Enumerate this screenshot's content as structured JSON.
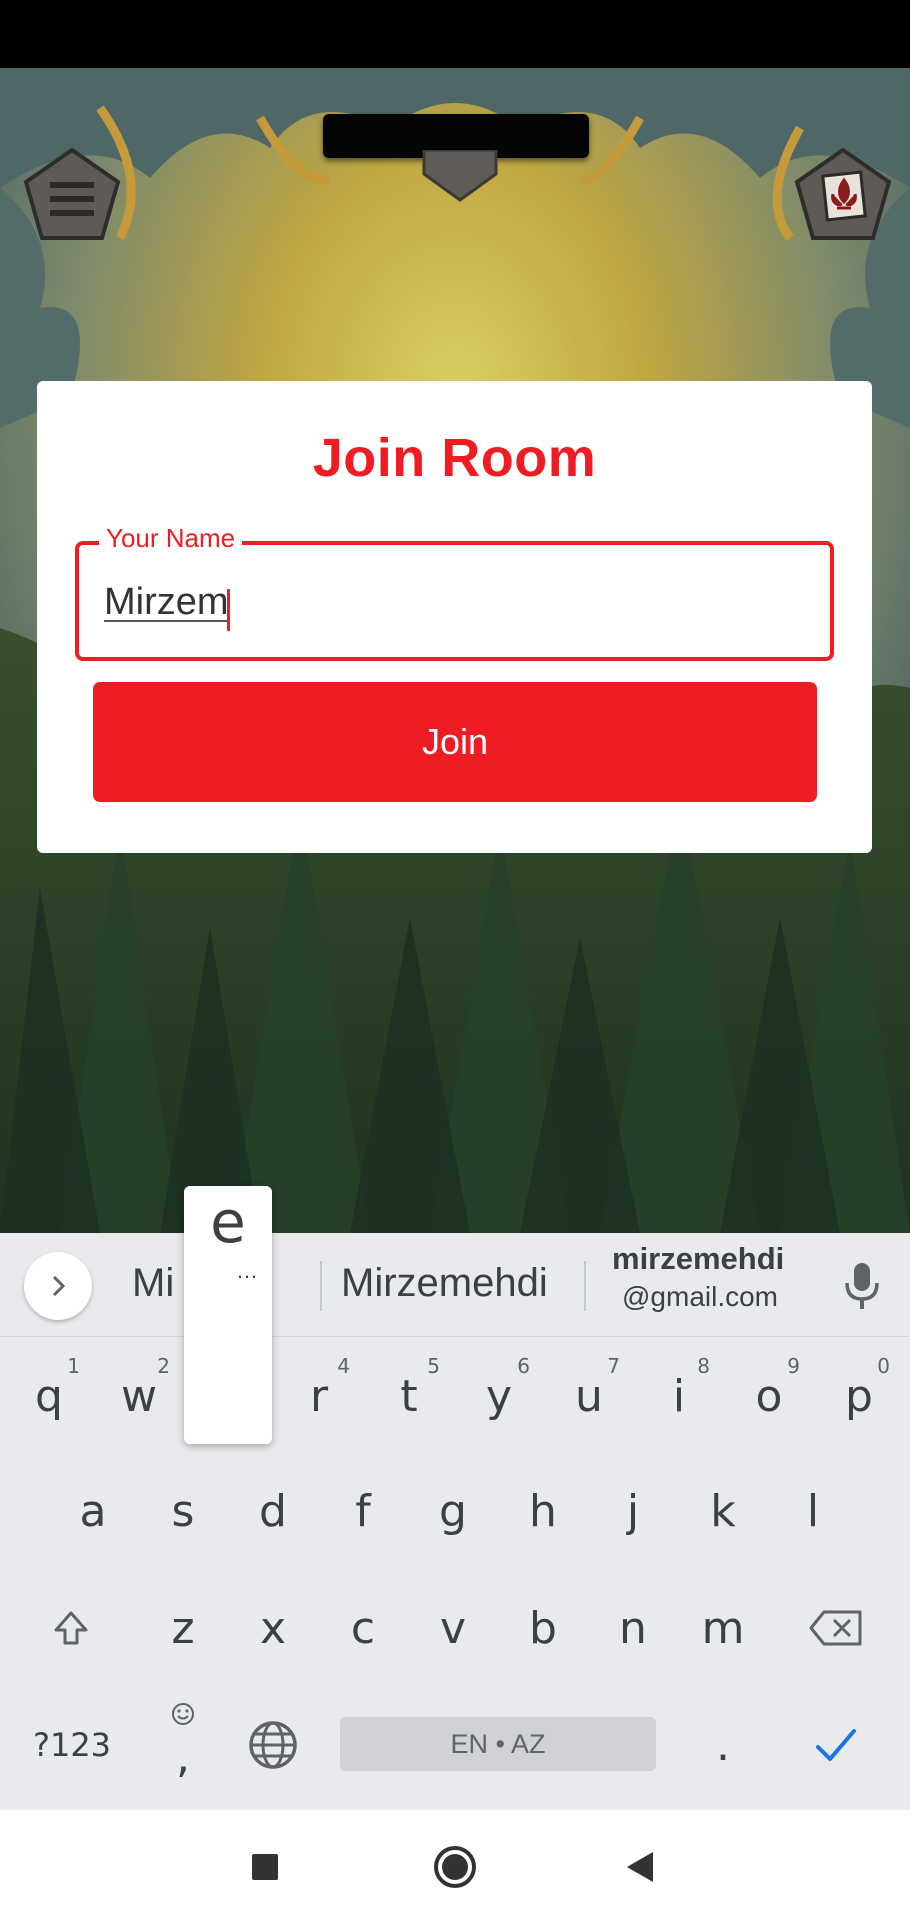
{
  "modal": {
    "title": "Join Room",
    "name_label": "Your Name",
    "name_value": "Mirzem",
    "join_label": "Join"
  },
  "keyboard": {
    "suggestions": [
      "Mi",
      "Mirzemehdi",
      "mirzemehdi",
      "@gmail.com"
    ],
    "popup_key": "e",
    "popup_more": "…",
    "row1": [
      "q",
      "w",
      "e",
      "r",
      "t",
      "y",
      "u",
      "i",
      "o",
      "p"
    ],
    "row1_hints": [
      "1",
      "2",
      "3",
      "4",
      "5",
      "6",
      "7",
      "8",
      "9",
      "0"
    ],
    "row2": [
      "a",
      "s",
      "d",
      "f",
      "g",
      "h",
      "j",
      "k",
      "l"
    ],
    "row3": [
      "z",
      "x",
      "c",
      "v",
      "b",
      "n",
      "m"
    ],
    "symbols_label": "?123",
    "comma_label": ",",
    "period_label": ".",
    "space_label": "EN • AZ"
  },
  "icons": {
    "menu": "hamburger-icon",
    "suit": "fleur-de-lis-icon",
    "expand": "chevron-right-icon",
    "mic": "mic-icon",
    "shift": "shift-icon",
    "backspace": "backspace-icon",
    "emoji": "emoji-icon",
    "globe": "globe-icon",
    "enter": "checkmark-icon",
    "recents": "square-icon",
    "home": "circle-icon",
    "back": "triangle-back-icon"
  },
  "colors": {
    "accent": "#ef1c23",
    "keyboard_bg": "#e8eaed",
    "key_text": "#3c4043",
    "enter_check": "#1a73e8"
  }
}
